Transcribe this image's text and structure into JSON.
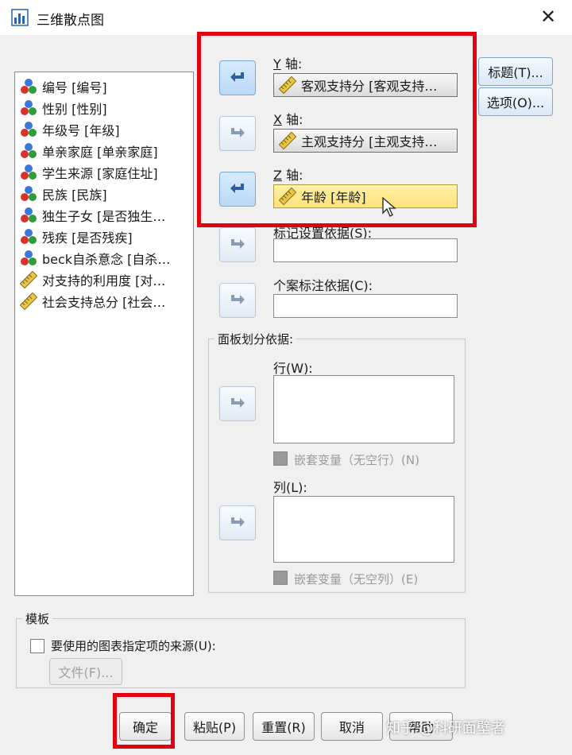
{
  "window": {
    "title": "三维散点图",
    "close_icon": "close-icon"
  },
  "variables": [
    {
      "label": "编号 [编号]",
      "icon": "nominal-icon"
    },
    {
      "label": "性别 [性别]",
      "icon": "nominal-icon"
    },
    {
      "label": "年级号 [年级]",
      "icon": "nominal-icon"
    },
    {
      "label": "单亲家庭 [单亲家庭]",
      "icon": "nominal-icon"
    },
    {
      "label": "学生来源 [家庭住址]",
      "icon": "nominal-icon"
    },
    {
      "label": "民族 [民族]",
      "icon": "nominal-icon"
    },
    {
      "label": "独生子女 [是否独生…",
      "icon": "nominal-icon"
    },
    {
      "label": "残疾 [是否残疾]",
      "icon": "nominal-icon"
    },
    {
      "label": "beck自杀意念 [自杀…",
      "icon": "nominal-icon"
    },
    {
      "label": "对支持的利用度 [对…",
      "icon": "scale-icon"
    },
    {
      "label": "社会支持总分 [社会…",
      "icon": "scale-icon"
    }
  ],
  "axes": {
    "y": {
      "key": "Y",
      "label": " 轴:",
      "value": "客观支持分 [客观支持…"
    },
    "x": {
      "key": "X",
      "label": " 轴:",
      "value": "主观支持分 [主观支持…"
    },
    "z": {
      "key": "Z",
      "label": " 轴:",
      "value": "年龄 [年龄]"
    }
  },
  "marker_set": {
    "label": "标记设置依据(S):",
    "value": ""
  },
  "case_label": {
    "label": "个案标注依据(C):",
    "value": ""
  },
  "panel": {
    "title": "面板划分依据:",
    "rows_label": "行(W):",
    "rows_nest": "嵌套变量（无空行）(N)",
    "cols_label": "列(L):",
    "cols_nest": "嵌套变量（无空列）(E)"
  },
  "side_buttons": {
    "title": "标题(T)...",
    "options": "选项(O)..."
  },
  "template": {
    "title": "模板",
    "checkbox_label": "要使用的图表指定项的来源(U):",
    "file_button": "文件(F)..."
  },
  "footer": {
    "ok": "确定",
    "paste": "粘贴(P)",
    "reset": "重置(R)",
    "cancel": "取消",
    "help": "帮助"
  },
  "watermark": "知乎 @科研面壁者",
  "colors": {
    "highlight_red": "#e3000f",
    "selected_field": "#ffe27a"
  }
}
